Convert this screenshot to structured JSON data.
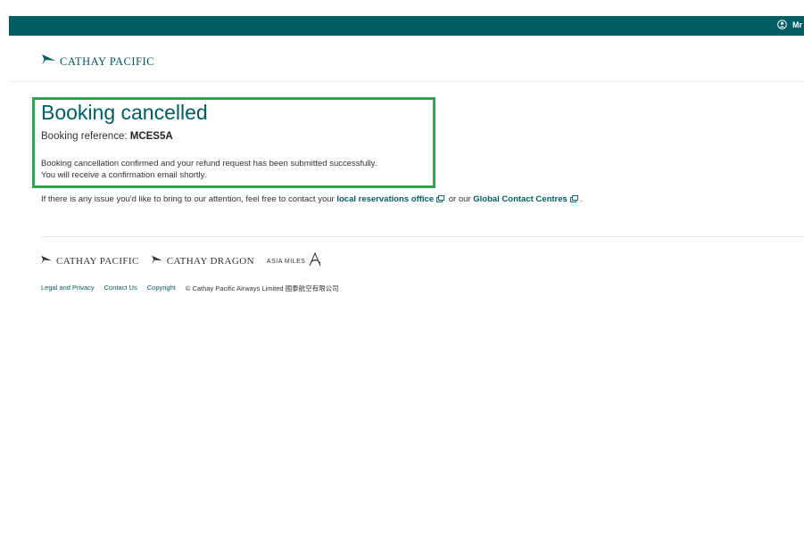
{
  "topbar": {
    "user_label": "Mr"
  },
  "header": {
    "logo_text": "CATHAY PACIFIC"
  },
  "main": {
    "title": "Booking cancelled",
    "booking_ref_label": "Booking reference:",
    "booking_ref_value": "MCES5A",
    "confirm_line1": "Booking cancellation confirmed and your refund request has been submitted successfully.",
    "confirm_line2": "You will receive a confirmation email shortly.",
    "contact_prefix": "If there is any issue you'd like to bring to our attention, feel free to contact your",
    "contact_link1": "local reservations office",
    "contact_middle": "or our",
    "contact_link2": "Global Contact Centres",
    "contact_suffix": "."
  },
  "footer": {
    "brand1": "CATHAY PACIFIC",
    "brand2": "CATHAY DRAGON",
    "brand3": "ASIA MILES",
    "links": [
      "Legal and Privacy",
      "Contact Us",
      "Copyright"
    ],
    "copyright": "© Cathay Pacific Airways Limited 國泰航空有限公司"
  },
  "colors": {
    "brand_teal": "#005d63",
    "highlight_green": "#2ea84a"
  },
  "icons": [
    "user-icon",
    "brushwing-logo-icon",
    "external-link-icon"
  ]
}
